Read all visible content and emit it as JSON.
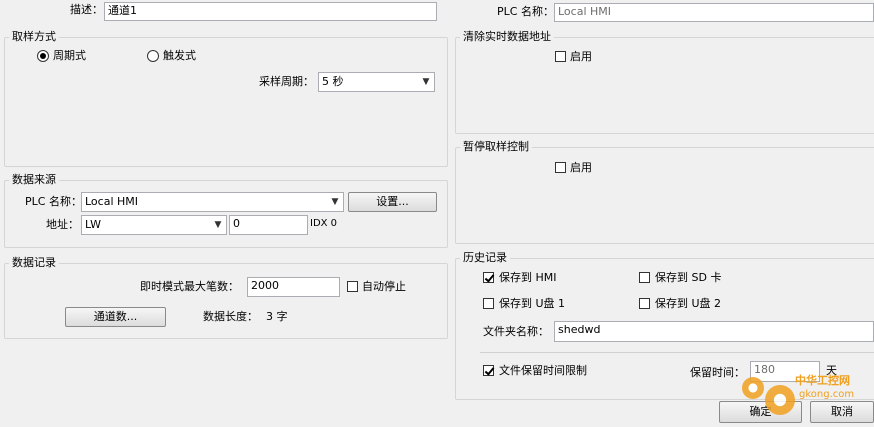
{
  "top": {
    "desc_label": "描述：",
    "desc_value": "通道1",
    "plc_label": "PLC 名称：",
    "plc_value": "Local HMI"
  },
  "sampling": {
    "title": "取样方式",
    "radio_periodic": "周期式",
    "radio_trigger": "触发式",
    "period_label": "采样周期：",
    "period_value": "5 秒"
  },
  "clear_realtime": {
    "title": "清除实时数据地址",
    "enable_label": "启用"
  },
  "pause_sampling": {
    "title": "暂停取样控制",
    "enable_label": "启用"
  },
  "source": {
    "title": "数据来源",
    "plc_label": "PLC 名称：",
    "plc_value": "Local HMI",
    "settings_button": "设置...",
    "address_label": "地址：",
    "address_type": "LW",
    "address_value": "0",
    "idx_text": "IDX 0"
  },
  "record": {
    "title": "数据记录",
    "max_label": "即时模式最大笔数：",
    "max_value": "2000",
    "auto_stop_label": "自动停止",
    "channels_button": "通道数...",
    "length_label": "数据长度：",
    "length_value": "3 字"
  },
  "history": {
    "title": "历史记录",
    "save_hmi": "保存到 HMI",
    "save_sd": "保存到 SD 卡",
    "save_usb1": "保存到 U盘 1",
    "save_usb2": "保存到 U盘 2",
    "folder_label": "文件夹名称：",
    "folder_value": "shedwd",
    "retention_label": "文件保留时间限制",
    "keep_time_label": "保留时间：",
    "keep_time_value": "180",
    "keep_time_unit": "天"
  },
  "footer": {
    "ok_button": "确定",
    "cancel_button": "取消"
  },
  "watermark": {
    "text_cn": "中华工控网",
    "text_url": "gkong.com"
  },
  "colors": {
    "watermark": "#f0a020",
    "background": "#f0f0f0"
  }
}
